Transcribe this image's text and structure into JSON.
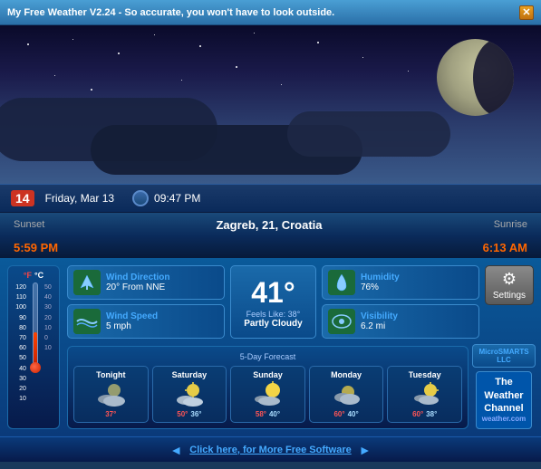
{
  "titlebar": {
    "title": "My Free Weather V2.24  -  So accurate, you won't have to look outside.",
    "close_label": "✕"
  },
  "datetime": {
    "day_num": "14",
    "day_label": "14",
    "date_text": "Friday, Mar 13",
    "time_text": "09:47 PM"
  },
  "location": {
    "city": "Zagreb, 21, Croatia",
    "sunset_label": "Sunset",
    "sunrise_label": "Sunrise",
    "sunset_time": "5:59 PM",
    "sunrise_time": "6:13 AM"
  },
  "weather": {
    "temp": "41°",
    "feels_like": "Feels Like: 38°",
    "condition": "Partly Cloudy",
    "wind_direction_label": "Wind Direction",
    "wind_direction_value": "20° From NNE",
    "wind_speed_label": "Wind Speed",
    "wind_speed_value": "5 mph",
    "humidity_label": "Humidity",
    "humidity_value": "76%",
    "visibility_label": "Visibility",
    "visibility_value": "6.2 mi"
  },
  "thermometer": {
    "f_label": "°F",
    "c_label": "°C",
    "f_scale": [
      "120",
      "110",
      "100",
      "90",
      "80",
      "70",
      "60",
      "50",
      "40",
      "30",
      "20",
      "10"
    ],
    "c_scale": [
      "50",
      "40",
      "30",
      "20",
      "10",
      "0",
      "10"
    ]
  },
  "forecast": {
    "title": "Forecast",
    "subtitle": "5-Day Forecast",
    "days": [
      {
        "name": "Tonight",
        "high": "37°",
        "low": ""
      },
      {
        "name": "Saturday",
        "high": "50°",
        "low": "36°"
      },
      {
        "name": "Sunday",
        "high": "58°",
        "low": "40°"
      },
      {
        "name": "Monday",
        "high": "60°",
        "low": "40°"
      },
      {
        "name": "Tuesday",
        "high": "60°",
        "low": "38°"
      }
    ]
  },
  "logos": {
    "micro_label": "MicroSMARTS LLC",
    "twc_line1": "The",
    "twc_line2": "Weather",
    "twc_line3": "Channel",
    "twc_url": "weather.com"
  },
  "settings": {
    "label": "Settings"
  },
  "bottom_bar": {
    "link_text": "Click here, for More Free Software"
  }
}
